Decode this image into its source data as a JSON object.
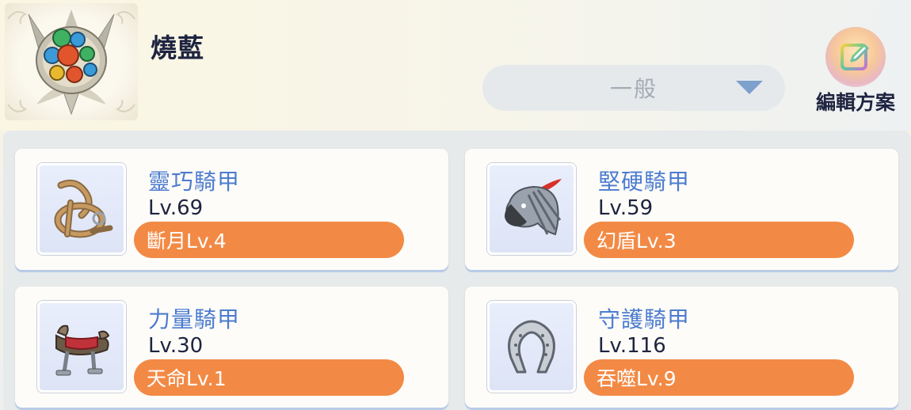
{
  "profile": {
    "name": "燒藍",
    "emblem_icon": "gem-emblem-icon"
  },
  "mode_dropdown": {
    "selected": "一般",
    "chevron_icon": "chevron-down-icon"
  },
  "edit_plan": {
    "label": "編輯方案",
    "icon": "edit-pencil-icon"
  },
  "armors": [
    {
      "name": "靈巧騎甲",
      "level": "Lv.69",
      "skill": "斷月Lv.4",
      "icon": "harness-icon"
    },
    {
      "name": "堅硬騎甲",
      "level": "Lv.59",
      "skill": "幻盾Lv.3",
      "icon": "horse-helm-icon"
    },
    {
      "name": "力量騎甲",
      "level": "Lv.30",
      "skill": "天命Lv.1",
      "icon": "saddle-icon"
    },
    {
      "name": "守護騎甲",
      "level": "Lv.116",
      "skill": "吞噬Lv.9",
      "icon": "horseshoe-icon"
    }
  ],
  "colors": {
    "armor_name": "#4c7bd0",
    "skill_pill": "#f28a45",
    "dropdown_bg": "#e6e9ec",
    "card_shadow": "#b8cce7"
  }
}
